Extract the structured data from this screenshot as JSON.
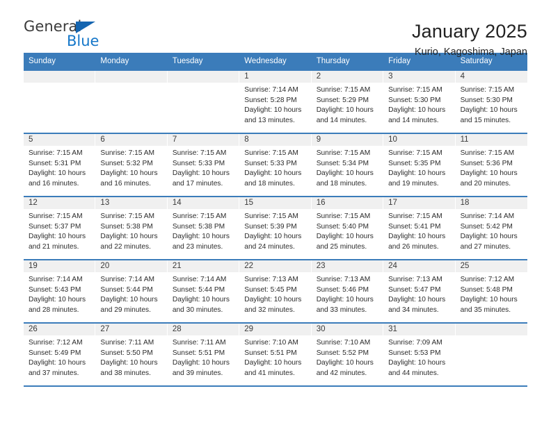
{
  "logo": {
    "word1": "General",
    "word2": "Blue",
    "triangle_color": "#1565b0",
    "blue_color": "#1577c9",
    "gray_color": "#3b3b3b"
  },
  "header": {
    "title": "January 2025",
    "subtitle": "Kurio, Kagoshima, Japan"
  },
  "theme": {
    "header_band": "#3b7cba",
    "day_band": "#f0f0f0",
    "cell_bg": "#ffffff",
    "text": "#2b2b2b"
  },
  "weekdays": [
    "Sunday",
    "Monday",
    "Tuesday",
    "Wednesday",
    "Thursday",
    "Friday",
    "Saturday"
  ],
  "weeks": [
    [
      {
        "day": "",
        "sunrise": "",
        "sunset": "",
        "daylight1": "",
        "daylight2": ""
      },
      {
        "day": "",
        "sunrise": "",
        "sunset": "",
        "daylight1": "",
        "daylight2": ""
      },
      {
        "day": "",
        "sunrise": "",
        "sunset": "",
        "daylight1": "",
        "daylight2": ""
      },
      {
        "day": "1",
        "sunrise": "Sunrise: 7:14 AM",
        "sunset": "Sunset: 5:28 PM",
        "daylight1": "Daylight: 10 hours",
        "daylight2": "and 13 minutes."
      },
      {
        "day": "2",
        "sunrise": "Sunrise: 7:15 AM",
        "sunset": "Sunset: 5:29 PM",
        "daylight1": "Daylight: 10 hours",
        "daylight2": "and 14 minutes."
      },
      {
        "day": "3",
        "sunrise": "Sunrise: 7:15 AM",
        "sunset": "Sunset: 5:30 PM",
        "daylight1": "Daylight: 10 hours",
        "daylight2": "and 14 minutes."
      },
      {
        "day": "4",
        "sunrise": "Sunrise: 7:15 AM",
        "sunset": "Sunset: 5:30 PM",
        "daylight1": "Daylight: 10 hours",
        "daylight2": "and 15 minutes."
      }
    ],
    [
      {
        "day": "5",
        "sunrise": "Sunrise: 7:15 AM",
        "sunset": "Sunset: 5:31 PM",
        "daylight1": "Daylight: 10 hours",
        "daylight2": "and 16 minutes."
      },
      {
        "day": "6",
        "sunrise": "Sunrise: 7:15 AM",
        "sunset": "Sunset: 5:32 PM",
        "daylight1": "Daylight: 10 hours",
        "daylight2": "and 16 minutes."
      },
      {
        "day": "7",
        "sunrise": "Sunrise: 7:15 AM",
        "sunset": "Sunset: 5:33 PM",
        "daylight1": "Daylight: 10 hours",
        "daylight2": "and 17 minutes."
      },
      {
        "day": "8",
        "sunrise": "Sunrise: 7:15 AM",
        "sunset": "Sunset: 5:33 PM",
        "daylight1": "Daylight: 10 hours",
        "daylight2": "and 18 minutes."
      },
      {
        "day": "9",
        "sunrise": "Sunrise: 7:15 AM",
        "sunset": "Sunset: 5:34 PM",
        "daylight1": "Daylight: 10 hours",
        "daylight2": "and 18 minutes."
      },
      {
        "day": "10",
        "sunrise": "Sunrise: 7:15 AM",
        "sunset": "Sunset: 5:35 PM",
        "daylight1": "Daylight: 10 hours",
        "daylight2": "and 19 minutes."
      },
      {
        "day": "11",
        "sunrise": "Sunrise: 7:15 AM",
        "sunset": "Sunset: 5:36 PM",
        "daylight1": "Daylight: 10 hours",
        "daylight2": "and 20 minutes."
      }
    ],
    [
      {
        "day": "12",
        "sunrise": "Sunrise: 7:15 AM",
        "sunset": "Sunset: 5:37 PM",
        "daylight1": "Daylight: 10 hours",
        "daylight2": "and 21 minutes."
      },
      {
        "day": "13",
        "sunrise": "Sunrise: 7:15 AM",
        "sunset": "Sunset: 5:38 PM",
        "daylight1": "Daylight: 10 hours",
        "daylight2": "and 22 minutes."
      },
      {
        "day": "14",
        "sunrise": "Sunrise: 7:15 AM",
        "sunset": "Sunset: 5:38 PM",
        "daylight1": "Daylight: 10 hours",
        "daylight2": "and 23 minutes."
      },
      {
        "day": "15",
        "sunrise": "Sunrise: 7:15 AM",
        "sunset": "Sunset: 5:39 PM",
        "daylight1": "Daylight: 10 hours",
        "daylight2": "and 24 minutes."
      },
      {
        "day": "16",
        "sunrise": "Sunrise: 7:15 AM",
        "sunset": "Sunset: 5:40 PM",
        "daylight1": "Daylight: 10 hours",
        "daylight2": "and 25 minutes."
      },
      {
        "day": "17",
        "sunrise": "Sunrise: 7:15 AM",
        "sunset": "Sunset: 5:41 PM",
        "daylight1": "Daylight: 10 hours",
        "daylight2": "and 26 minutes."
      },
      {
        "day": "18",
        "sunrise": "Sunrise: 7:14 AM",
        "sunset": "Sunset: 5:42 PM",
        "daylight1": "Daylight: 10 hours",
        "daylight2": "and 27 minutes."
      }
    ],
    [
      {
        "day": "19",
        "sunrise": "Sunrise: 7:14 AM",
        "sunset": "Sunset: 5:43 PM",
        "daylight1": "Daylight: 10 hours",
        "daylight2": "and 28 minutes."
      },
      {
        "day": "20",
        "sunrise": "Sunrise: 7:14 AM",
        "sunset": "Sunset: 5:44 PM",
        "daylight1": "Daylight: 10 hours",
        "daylight2": "and 29 minutes."
      },
      {
        "day": "21",
        "sunrise": "Sunrise: 7:14 AM",
        "sunset": "Sunset: 5:44 PM",
        "daylight1": "Daylight: 10 hours",
        "daylight2": "and 30 minutes."
      },
      {
        "day": "22",
        "sunrise": "Sunrise: 7:13 AM",
        "sunset": "Sunset: 5:45 PM",
        "daylight1": "Daylight: 10 hours",
        "daylight2": "and 32 minutes."
      },
      {
        "day": "23",
        "sunrise": "Sunrise: 7:13 AM",
        "sunset": "Sunset: 5:46 PM",
        "daylight1": "Daylight: 10 hours",
        "daylight2": "and 33 minutes."
      },
      {
        "day": "24",
        "sunrise": "Sunrise: 7:13 AM",
        "sunset": "Sunset: 5:47 PM",
        "daylight1": "Daylight: 10 hours",
        "daylight2": "and 34 minutes."
      },
      {
        "day": "25",
        "sunrise": "Sunrise: 7:12 AM",
        "sunset": "Sunset: 5:48 PM",
        "daylight1": "Daylight: 10 hours",
        "daylight2": "and 35 minutes."
      }
    ],
    [
      {
        "day": "26",
        "sunrise": "Sunrise: 7:12 AM",
        "sunset": "Sunset: 5:49 PM",
        "daylight1": "Daylight: 10 hours",
        "daylight2": "and 37 minutes."
      },
      {
        "day": "27",
        "sunrise": "Sunrise: 7:11 AM",
        "sunset": "Sunset: 5:50 PM",
        "daylight1": "Daylight: 10 hours",
        "daylight2": "and 38 minutes."
      },
      {
        "day": "28",
        "sunrise": "Sunrise: 7:11 AM",
        "sunset": "Sunset: 5:51 PM",
        "daylight1": "Daylight: 10 hours",
        "daylight2": "and 39 minutes."
      },
      {
        "day": "29",
        "sunrise": "Sunrise: 7:10 AM",
        "sunset": "Sunset: 5:51 PM",
        "daylight1": "Daylight: 10 hours",
        "daylight2": "and 41 minutes."
      },
      {
        "day": "30",
        "sunrise": "Sunrise: 7:10 AM",
        "sunset": "Sunset: 5:52 PM",
        "daylight1": "Daylight: 10 hours",
        "daylight2": "and 42 minutes."
      },
      {
        "day": "31",
        "sunrise": "Sunrise: 7:09 AM",
        "sunset": "Sunset: 5:53 PM",
        "daylight1": "Daylight: 10 hours",
        "daylight2": "and 44 minutes."
      },
      {
        "day": "",
        "sunrise": "",
        "sunset": "",
        "daylight1": "",
        "daylight2": ""
      }
    ]
  ]
}
